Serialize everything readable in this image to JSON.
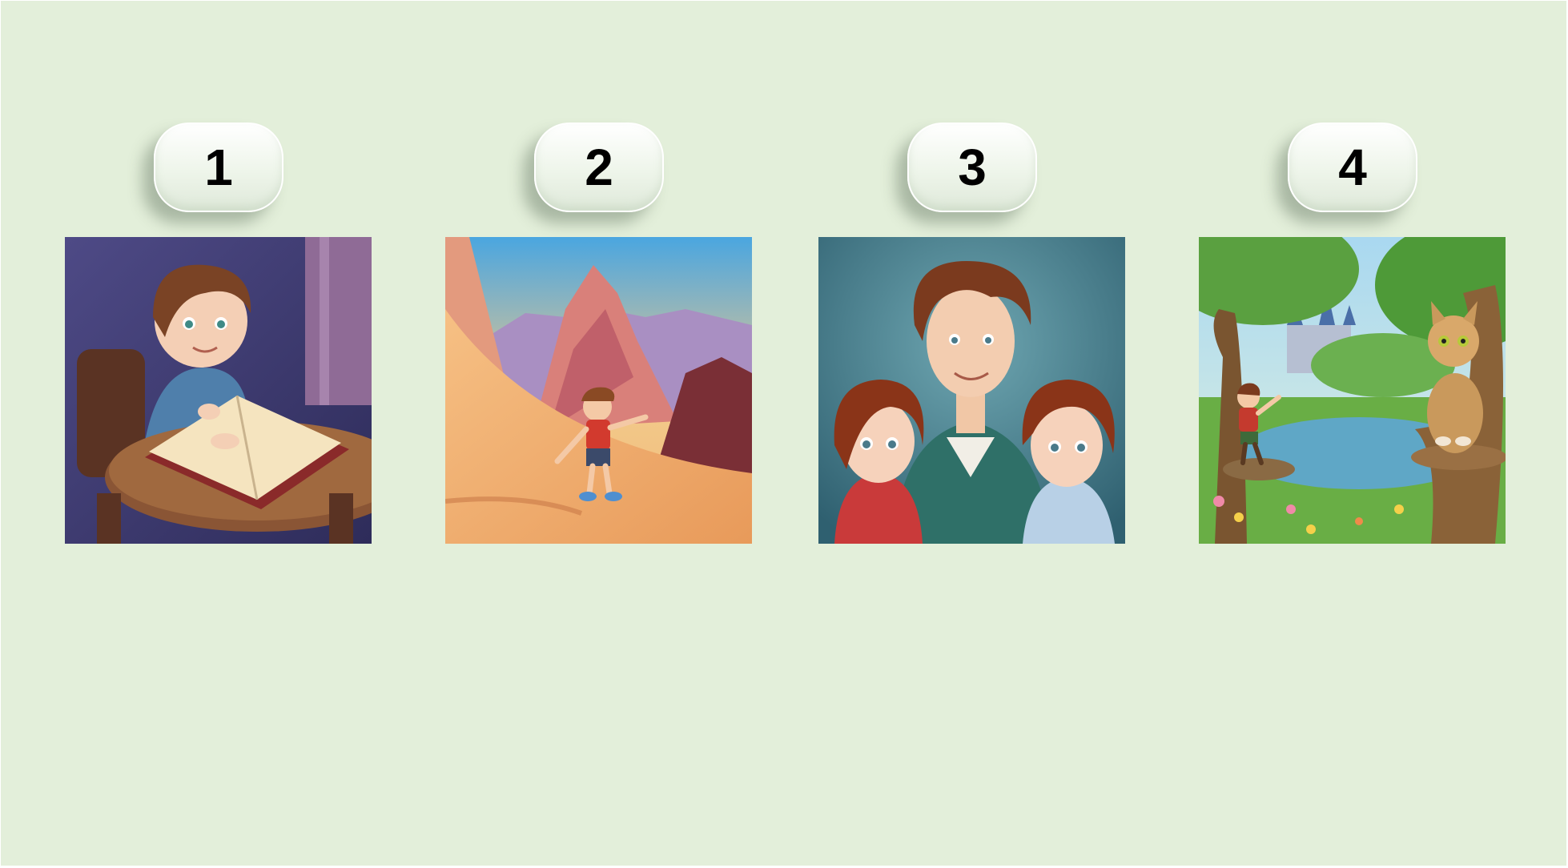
{
  "slide": {
    "background": "#e3efda"
  },
  "cards": [
    {
      "number": "1",
      "illustration": "girl-reading-book-at-table"
    },
    {
      "number": "2",
      "illustration": "boy-on-mountain-dune"
    },
    {
      "number": "3",
      "illustration": "father-with-two-children"
    },
    {
      "number": "4",
      "illustration": "boy-and-cat-by-castle-pond"
    }
  ]
}
